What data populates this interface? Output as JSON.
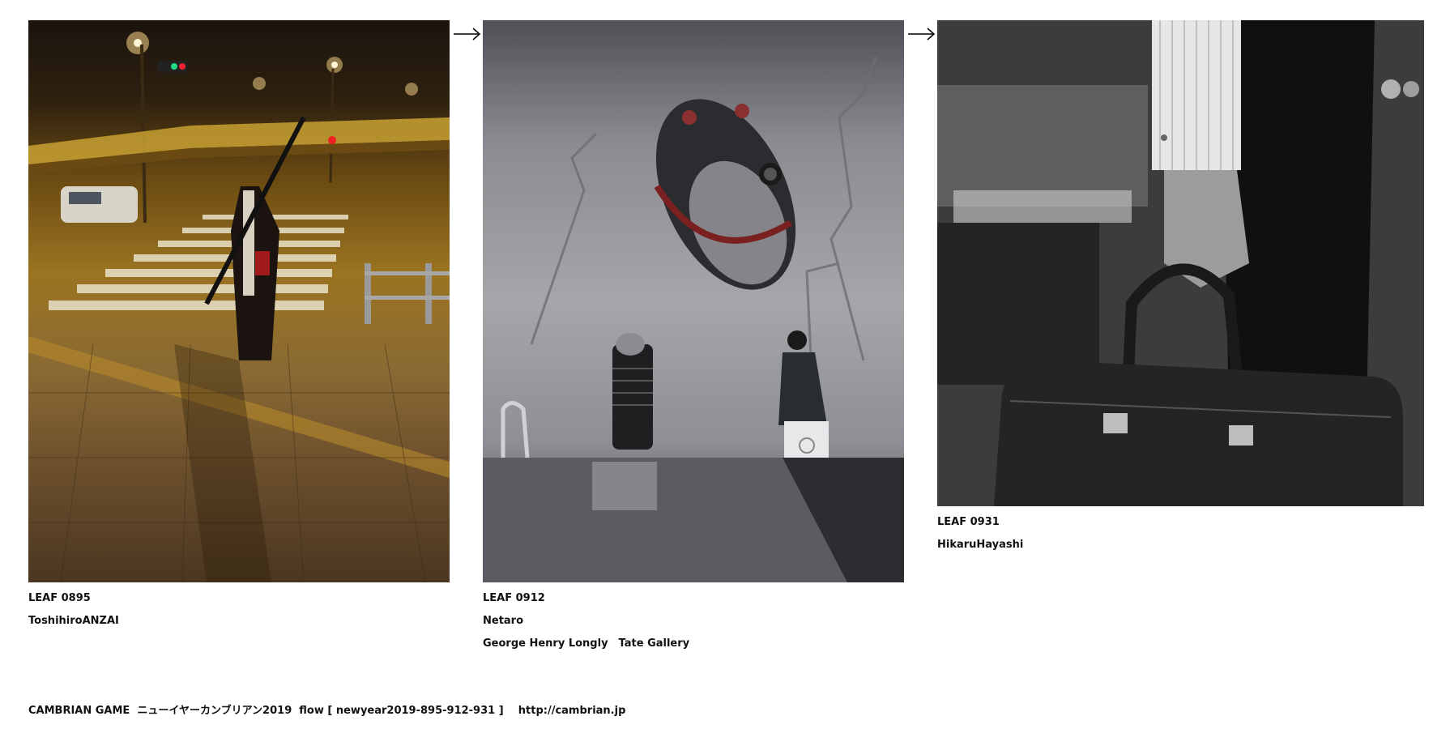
{
  "leaves": [
    {
      "title": "LEAF 0895",
      "author": "ToshihiroANZAI",
      "note": ""
    },
    {
      "title": "LEAF 0912",
      "author": "Netaro",
      "note": "George Henry Longly　Tate Gallery"
    },
    {
      "title": "LEAF 0931",
      "author": "HikaruHayashi",
      "note": ""
    }
  ],
  "footer": {
    "text": "CAMBRIAN GAME  ニューイヤーカンブリアン2019  flow [ newyear2019-895-912-931 ]    http://cambrian.jp"
  }
}
